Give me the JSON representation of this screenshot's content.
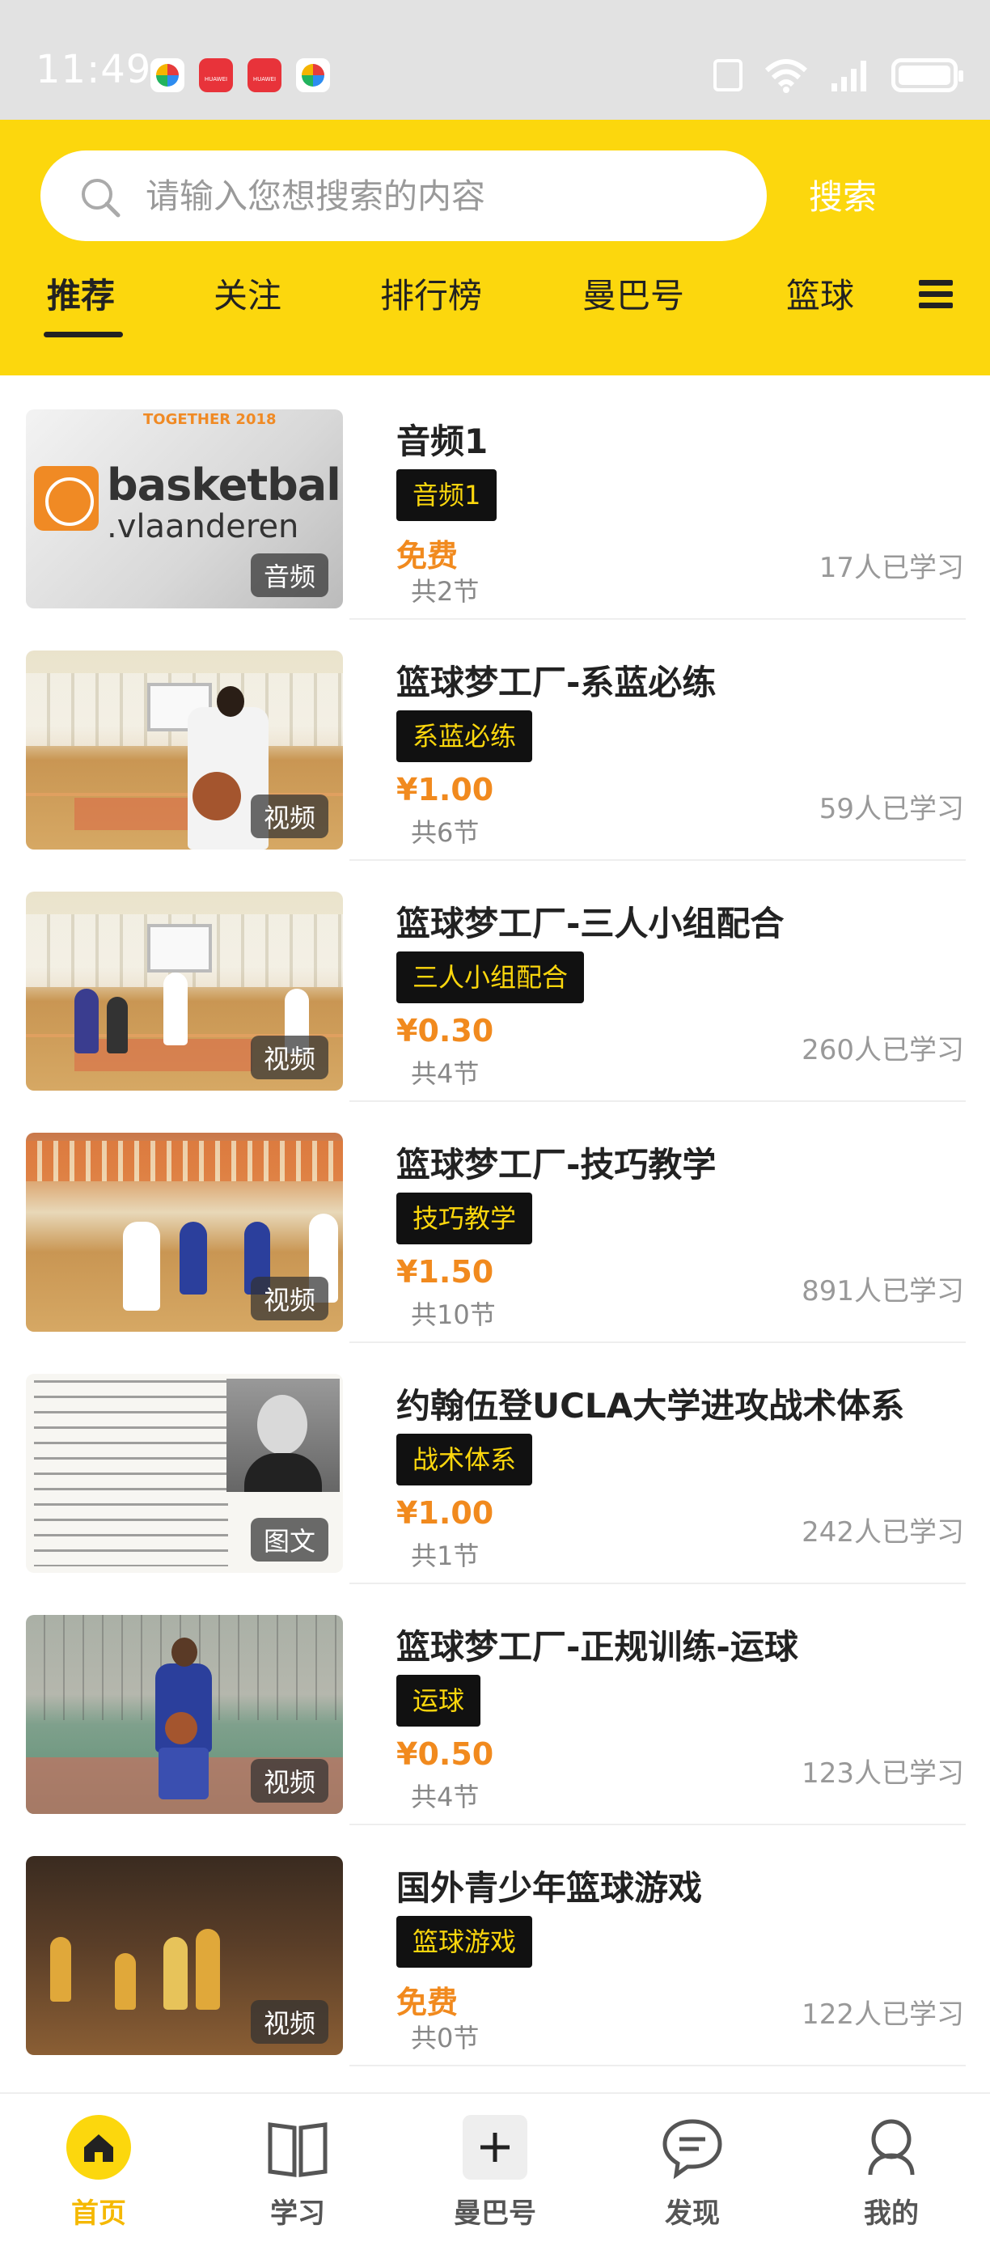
{
  "status_bar": {
    "time": "11:49",
    "apps": [
      "multicolor-app-icon",
      "huawei-app-icon",
      "huawei-app-icon",
      "multicolor-app-icon"
    ],
    "icons": [
      "nfc-icon",
      "wifi-icon",
      "signal-icon",
      "battery-icon"
    ]
  },
  "header": {
    "search_placeholder": "请输入您想搜索的内容",
    "search_button": "搜索",
    "tabs": [
      "推荐",
      "关注",
      "排行榜",
      "曼巴号",
      "篮球"
    ],
    "active_tab": "推荐",
    "accent_color": "#fcd70d"
  },
  "items": [
    {
      "title": "音频1",
      "tag": "音频1",
      "price": "免费",
      "lessons": "共2节",
      "learners": "17人已学习",
      "media_type": "音频"
    },
    {
      "title": "篮球梦工厂-系蓝必练",
      "tag": "系蓝必练",
      "price": "¥1.00",
      "lessons": "共6节",
      "learners": "59人已学习",
      "media_type": "视频"
    },
    {
      "title": "篮球梦工厂-三人小组配合",
      "tag": "三人小组配合",
      "price": "¥0.30",
      "lessons": "共4节",
      "learners": "260人已学习",
      "media_type": "视频"
    },
    {
      "title": "篮球梦工厂-技巧教学",
      "tag": "技巧教学",
      "price": "¥1.50",
      "lessons": "共10节",
      "learners": "891人已学习",
      "media_type": "视频"
    },
    {
      "title": "约翰伍登UCLA大学进攻战术体系",
      "tag": "战术体系",
      "price": "¥1.00",
      "lessons": "共1节",
      "learners": "242人已学习",
      "media_type": "图文"
    },
    {
      "title": "篮球梦工厂-正规训练-运球",
      "tag": "运球",
      "price": "¥0.50",
      "lessons": "共4节",
      "learners": "123人已学习",
      "media_type": "视频"
    },
    {
      "title": "国外青少年篮球游戏",
      "tag": "篮球游戏",
      "price": "免费",
      "lessons": "共0节",
      "learners": "122人已学习",
      "media_type": "视频"
    }
  ],
  "thumb_text": {
    "logo_word1": "basketbal",
    "logo_word2": ".vlaanderen",
    "logo_top": "TOGETHER 2018"
  },
  "bottom_nav": {
    "items": [
      "首页",
      "学习",
      "曼巴号",
      "发现",
      "我的"
    ],
    "active": "首页"
  }
}
